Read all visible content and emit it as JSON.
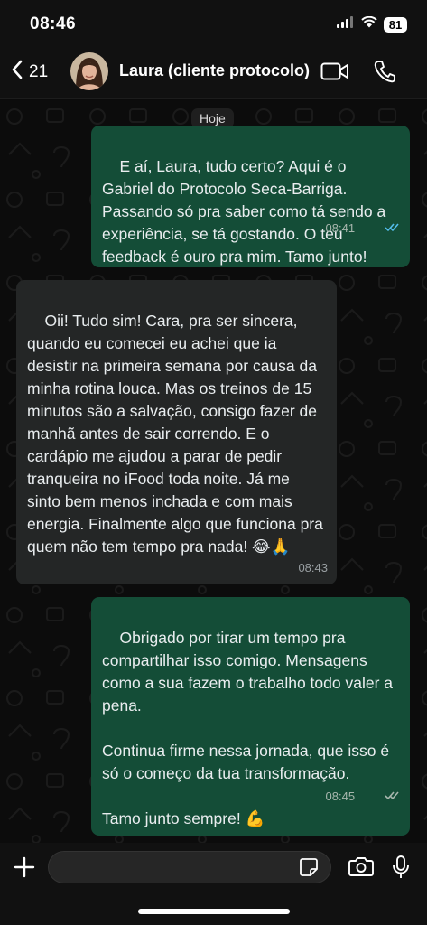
{
  "status_bar": {
    "time": "08:46",
    "battery": "81"
  },
  "header": {
    "back_count": "21",
    "contact_name": "Laura (cliente protocolo)"
  },
  "chat": {
    "date_divider": "Hoje",
    "messages": [
      {
        "direction": "outgoing",
        "text": "E aí, Laura, tudo certo? Aqui é o Gabriel do Protocolo Seca-Barriga. Passando só pra saber como tá sendo a experiência, se tá gostando. O teu feedback é ouro pra mim. Tamo junto!",
        "time": "08:41",
        "status": "read"
      },
      {
        "direction": "incoming",
        "text": "Oii! Tudo sim! Cara, pra ser sincera, quando eu comecei eu achei que ia desistir na primeira semana por causa da minha rotina louca. Mas os treinos de 15 minutos são a salvação, consigo fazer de manhã antes de sair correndo. E o cardápio me ajudou a parar de pedir tranqueira no iFood toda noite. Já me sinto bem menos inchada e com mais energia. Finalmente algo que funciona pra quem não tem tempo pra nada! 😂🙏",
        "time": "08:43"
      },
      {
        "direction": "outgoing",
        "text": "Obrigado por tirar um tempo pra compartilhar isso comigo. Mensagens como a sua fazem o trabalho todo valer a pena.\n\nContinua firme nessa jornada, que isso é só o começo da tua transformação.\n\nTamo junto sempre! 💪",
        "time": "08:45",
        "status": "delivered"
      }
    ]
  },
  "colors": {
    "outgoing_bubble": "#144d37",
    "incoming_bubble": "#242626",
    "read_tick": "#53bdeb"
  },
  "icons": [
    "back-chevron-icon",
    "video-call-icon",
    "phone-icon",
    "plus-icon",
    "sticker-icon",
    "camera-icon",
    "microphone-icon"
  ]
}
